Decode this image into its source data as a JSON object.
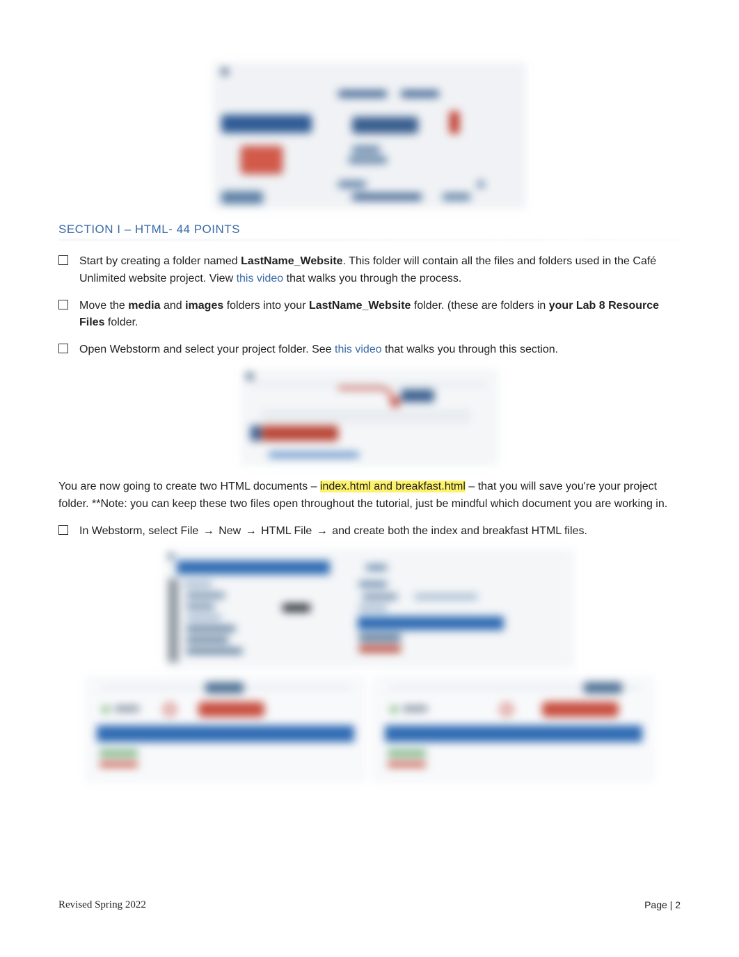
{
  "section": {
    "title": "SECTION I – HTML- 44 POINTS"
  },
  "items": {
    "i1": {
      "pre": "Start by creating a folder named ",
      "bold1": "LastName_Website",
      "mid": ". This folder will contain all the files and folders used in the Café Unlimited website project. View ",
      "link": "this video",
      "post": " that walks you through the process."
    },
    "i2": {
      "pre": "Move the ",
      "b1": "media",
      "mid1": " and ",
      "b2": "images",
      "mid2": " folders into your ",
      "b3": "LastName_Website",
      "mid3": " folder. (these are folders in ",
      "b4": "your Lab 8 Resource Files",
      "post": " folder."
    },
    "i3": {
      "pre": "Open Webstorm and select your project folder. See ",
      "link": "this video",
      "post": " that walks you through this section."
    },
    "i4": {
      "pre": "In Webstorm, select File ",
      "arrow": "→",
      "m1": " New ",
      "m2": " HTML File ",
      "post": " and create both the index and breakfast HTML files."
    }
  },
  "para": {
    "pre": "You are now going to create two HTML documents – ",
    "hl": "index.html and breakfast.html",
    "mid": " – that you will save you're your project folder. **Note: you can keep these two files open throughout the tutorial, just be mindful which document you are working in."
  },
  "footer": {
    "left": "Revised Spring 2022",
    "right": "Page | 2"
  }
}
